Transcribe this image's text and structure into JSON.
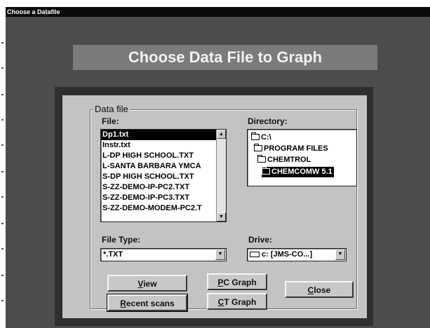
{
  "window": {
    "title": "Choose a Datafile"
  },
  "banner": {
    "title": "Choose Data File to Graph"
  },
  "group": {
    "title": "Data file"
  },
  "file": {
    "label": "File:",
    "items": [
      "Dp1.txt",
      "Instr.txt",
      "L-DP HIGH SCHOOL.TXT",
      "L-SANTA BARBARA YMCA",
      "S-DP HIGH SCHOOL.TXT",
      "S-ZZ-DEMO-IP-PC2.TXT",
      "S-ZZ-DEMO-IP-PC3.TXT",
      "S-ZZ-DEMO-MODEM-PC2.T"
    ],
    "selected_index": 0
  },
  "directory": {
    "label": "Directory:",
    "items": [
      "C:\\",
      "PROGRAM FILES",
      "CHEMTROL",
      "CHEMCOMW 5.1"
    ],
    "selected_index": 3
  },
  "file_type": {
    "label": "File Type:",
    "value": "*.TXT"
  },
  "drive": {
    "label": "Drive:",
    "value": "c: [JMS-CO...]"
  },
  "buttons": {
    "view": {
      "mnemonic": "V",
      "rest": "iew"
    },
    "recent": {
      "mnemonic": "R",
      "rest": "ecent scans"
    },
    "pc_graph": {
      "mnemonic": "P",
      "rest": "C Graph"
    },
    "ct_graph": {
      "mnemonic": "C",
      "rest": "T Graph"
    },
    "close": {
      "mnemonic": "C",
      "rest": "lose"
    }
  },
  "icons": {
    "scroll_up": "▲",
    "scroll_down": "▼",
    "dropdown": "▼"
  },
  "colors": {
    "title_bar": "#0a0a0a",
    "client_bg": "#4c4c4c",
    "banner_bg": "#7b7b7b",
    "dialog_bg": "#c3c3c3",
    "selection": "#000000"
  }
}
